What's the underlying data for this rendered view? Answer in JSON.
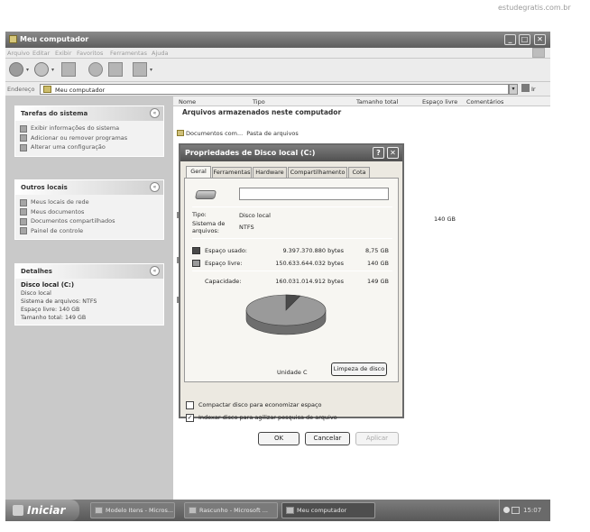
{
  "watermark": "estudegratis.com.br",
  "window": {
    "title": "Meu computador",
    "menu": [
      "Arquivo",
      "Editar",
      "Exibir",
      "Favoritos",
      "Ferramentas",
      "Ajuda"
    ],
    "address_label": "Endereço",
    "address_value": "Meu computador",
    "go_label": "Ir"
  },
  "taskpane": {
    "system_tasks": {
      "title": "Tarefas do sistema",
      "items": [
        "Exibir informações do sistema",
        "Adicionar ou remover programas",
        "Alterar uma configuração"
      ]
    },
    "other_places": {
      "title": "Outros locais",
      "items": [
        "Meus locais de rede",
        "Meus documentos",
        "Documentos compartilhados",
        "Painel de controle"
      ]
    },
    "details": {
      "title": "Detalhes",
      "name": "Disco local (C:)",
      "lines": [
        "Disco local",
        "Sistema de arquivos: NTFS",
        "Espaço livre: 140 GB",
        "Tamanho total: 149 GB"
      ]
    }
  },
  "list": {
    "columns": [
      "Nome",
      "Tipo",
      "Tamanho total",
      "Espaço livre",
      "Comentários"
    ],
    "group": "Arquivos armazenados neste computador",
    "row_name": "Documentos com...",
    "row_type": "Pasta de arquivos",
    "free_value": "140 GB"
  },
  "dialog": {
    "title": "Propriedades de Disco local (C:)",
    "tabs": [
      "Geral",
      "Ferramentas",
      "Hardware",
      "Compartilhamento",
      "Cota"
    ],
    "type_label": "Tipo:",
    "type_value": "Disco local",
    "fs_label_1": "Sistema de",
    "fs_label_2": "arquivos:",
    "fs_value": "NTFS",
    "used_label": "Espaço usado:",
    "used_bytes": "9.397.370.880 bytes",
    "used_gb": "8,75 GB",
    "free_label": "Espaço livre:",
    "free_bytes": "150.633.644.032 bytes",
    "free_gb": "140 GB",
    "cap_label": "Capacidade:",
    "cap_bytes": "160.031.014.912 bytes",
    "cap_gb": "149 GB",
    "drive_label": "Unidade C",
    "cleanup_button": "Limpeza de disco",
    "compress_label": "Compactar disco para economizar espaço",
    "index_label": "Indexar disco para agilizar pesquisa de arquivo",
    "compress_checked": false,
    "index_checked": true,
    "index_check_glyph": "✓",
    "ok": "OK",
    "cancel": "Cancelar",
    "apply": "Aplicar",
    "used_fraction": 0.0587,
    "colors": {
      "used": "#4a4a4a",
      "free": "#9a9a9a"
    }
  },
  "taskbar": {
    "start": "Iniciar",
    "tasks": [
      "Modelo Itens - Micros...",
      "Rascunho - Microsoft ...",
      "Meu computador"
    ],
    "clock": "15:07"
  },
  "icons": {
    "help": "?",
    "close": "✕",
    "minimize": "_",
    "maximize": "□",
    "collapse": "«",
    "dropdown": "▾",
    "back_forward": "▸"
  }
}
